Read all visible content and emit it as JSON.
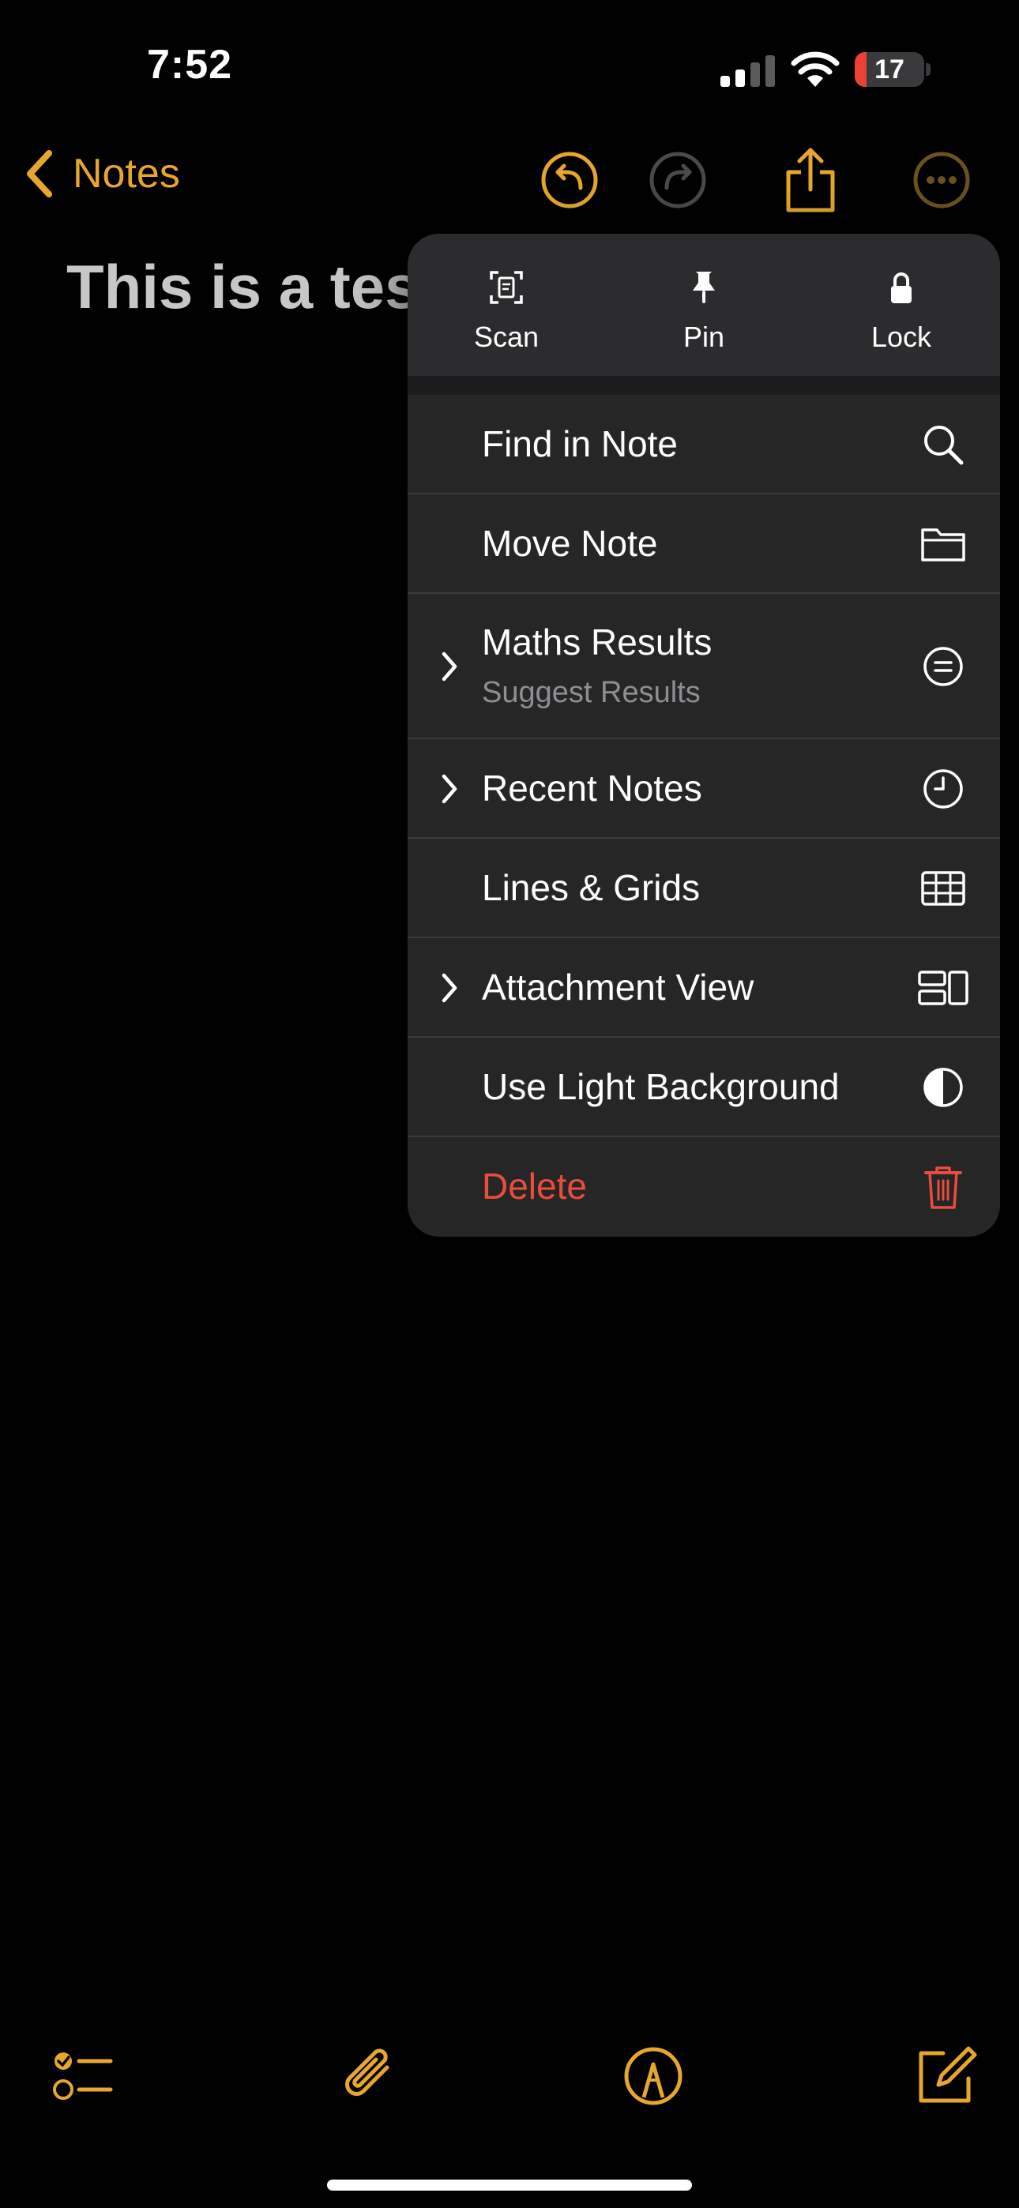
{
  "status_bar": {
    "time": "7:52",
    "battery_level": "17",
    "battery_fraction": 0.17
  },
  "nav": {
    "back_label": "Notes"
  },
  "note": {
    "title": "This is a test"
  },
  "menu": {
    "quick_actions": [
      {
        "label": "Scan",
        "icon": "doc-scan-icon"
      },
      {
        "label": "Pin",
        "icon": "pin-icon"
      },
      {
        "label": "Lock",
        "icon": "lock-icon"
      }
    ],
    "items": [
      {
        "label": "Find in Note",
        "icon": "magnifying-glass-icon",
        "submenu": false
      },
      {
        "label": "Move Note",
        "icon": "folder-icon",
        "submenu": false
      },
      {
        "label": "Maths Results",
        "sublabel": "Suggest Results",
        "icon": "equals-circle-icon",
        "submenu": true
      },
      {
        "label": "Recent Notes",
        "icon": "clock-icon",
        "submenu": true
      },
      {
        "label": "Lines & Grids",
        "icon": "grid-icon",
        "submenu": false
      },
      {
        "label": "Attachment View",
        "icon": "attachment-layout-icon",
        "submenu": true
      },
      {
        "label": "Use Light Background",
        "icon": "half-circle-icon",
        "submenu": false
      },
      {
        "label": "Delete",
        "icon": "trash-icon",
        "submenu": false,
        "destructive": true
      }
    ]
  },
  "colors": {
    "accent": "#e6a72c",
    "destructive": "#eb4d3d",
    "menu_background": "#262626",
    "battery_low": "#eb4034"
  }
}
